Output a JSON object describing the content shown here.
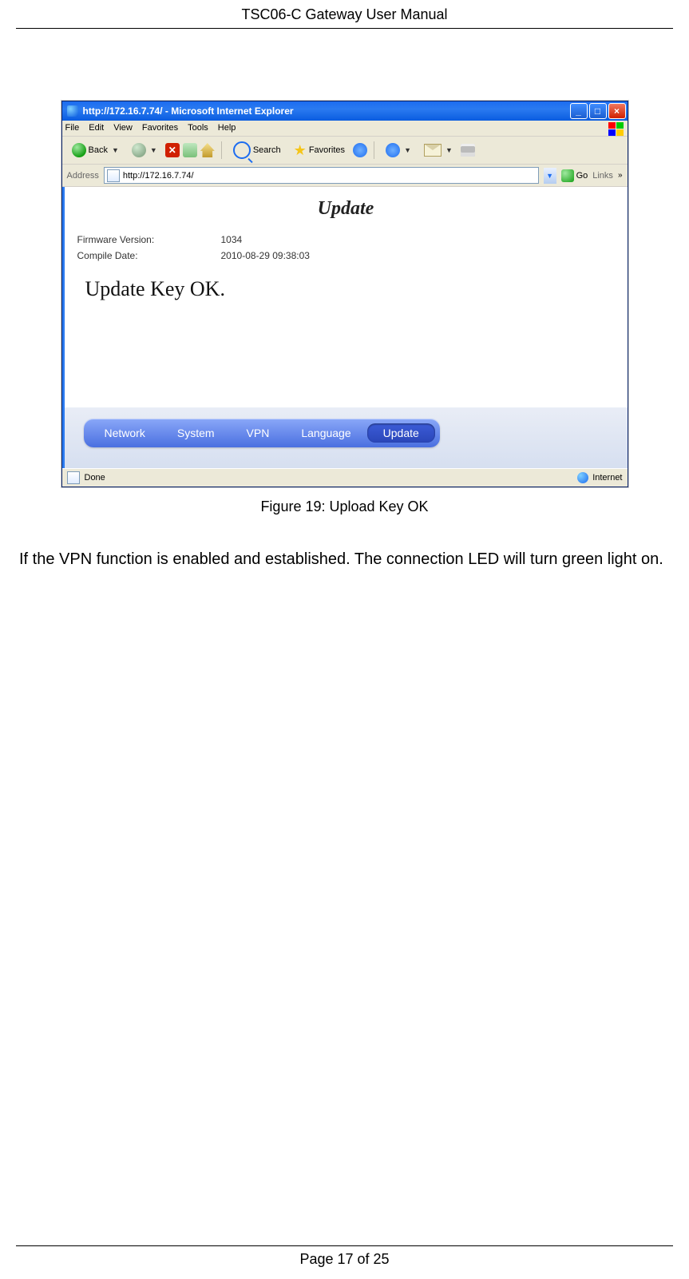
{
  "doc": {
    "header": "TSC06-C Gateway User Manual",
    "figure_caption": "Figure 19: Upload Key OK",
    "body_paragraph": "If the VPN function is enabled and established. The connection LED will turn green light on.",
    "footer": "Page 17 of 25"
  },
  "browser": {
    "title": "http://172.16.7.74/ - Microsoft Internet Explorer",
    "menu": {
      "file": "File",
      "edit": "Edit",
      "view": "View",
      "favorites": "Favorites",
      "tools": "Tools",
      "help": "Help"
    },
    "toolbar": {
      "back": "Back",
      "search": "Search",
      "favorites": "Favorites"
    },
    "address_label": "Address",
    "url": "http://172.16.7.74/",
    "go_label": "Go",
    "links_label": "Links",
    "status_done": "Done",
    "status_zone": "Internet"
  },
  "page_content": {
    "heading": "Update",
    "firmware_label": "Firmware Version:",
    "firmware_value": "1034",
    "compile_label": "Compile Date:",
    "compile_value": "2010-08-29 09:38:03",
    "update_msg": "Update Key OK."
  },
  "tabs": {
    "network": "Network",
    "system": "System",
    "vpn": "VPN",
    "language": "Language",
    "update": "Update"
  }
}
